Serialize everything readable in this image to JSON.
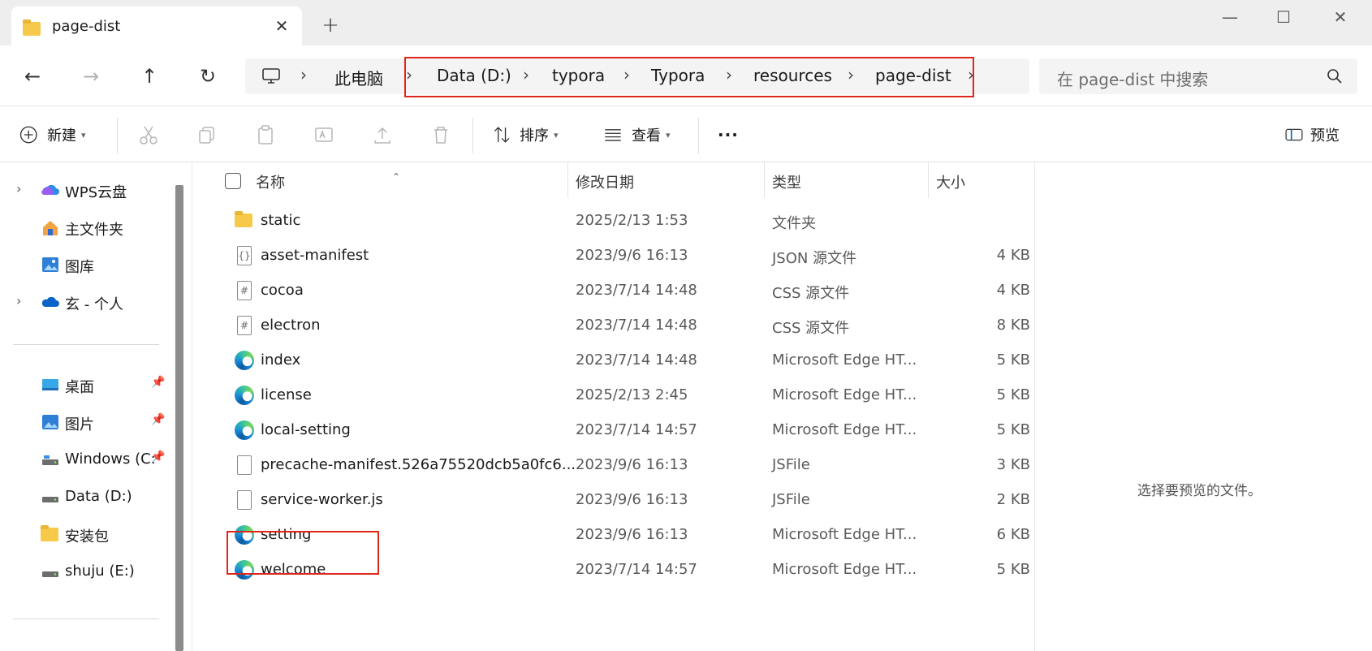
{
  "window": {
    "tab_title": "page-dist",
    "tab_close": "✕",
    "new_tab": "+",
    "minimize": "—",
    "maximize": "☐",
    "close": "✕"
  },
  "nav": {
    "back": "←",
    "forward": "→",
    "up": "↑",
    "refresh": "↻"
  },
  "breadcrumb": {
    "items": [
      "此电脑",
      "Data (D:)",
      "typora",
      "Typora",
      "resources",
      "page-dist"
    ],
    "separator": "›"
  },
  "search": {
    "placeholder": "在 page-dist 中搜索"
  },
  "toolbar": {
    "new_label": "新建",
    "sort_label": "排序",
    "view_label": "查看",
    "more_label": "···",
    "preview_label": "预览"
  },
  "sidebar": {
    "items": [
      {
        "label": "WPS云盘",
        "icon": "cloud-icon"
      },
      {
        "label": "主文件夹",
        "icon": "home-icon"
      },
      {
        "label": "图库",
        "icon": "gallery-icon"
      },
      {
        "label": "玄 - 个人",
        "icon": "onedrive-icon"
      },
      {
        "label": "桌面",
        "icon": "desktop-icon"
      },
      {
        "label": "图片",
        "icon": "pictures-icon"
      },
      {
        "label": "Windows (C:",
        "icon": "drive-icon"
      },
      {
        "label": "Data (D:)",
        "icon": "drive-icon"
      },
      {
        "label": "安装包",
        "icon": "folder-icon"
      },
      {
        "label": "shuju (E:)",
        "icon": "drive-icon"
      }
    ]
  },
  "columns": {
    "name": "名称",
    "date": "修改日期",
    "type": "类型",
    "size": "大小"
  },
  "files": [
    {
      "name": "static",
      "date": "2025/2/13 1:53",
      "type": "文件夹",
      "size": "",
      "icon": "folder-icon"
    },
    {
      "name": "asset-manifest",
      "date": "2023/9/6 16:13",
      "type": "JSON 源文件",
      "size": "4 KB",
      "icon": "json-file-icon"
    },
    {
      "name": "cocoa",
      "date": "2023/7/14 14:48",
      "type": "CSS 源文件",
      "size": "4 KB",
      "icon": "css-file-icon"
    },
    {
      "name": "electron",
      "date": "2023/7/14 14:48",
      "type": "CSS 源文件",
      "size": "8 KB",
      "icon": "css-file-icon"
    },
    {
      "name": "index",
      "date": "2023/7/14 14:48",
      "type": "Microsoft Edge HT...",
      "size": "5 KB",
      "icon": "edge-icon"
    },
    {
      "name": "license",
      "date": "2025/2/13 2:45",
      "type": "Microsoft Edge HT...",
      "size": "5 KB",
      "icon": "edge-icon"
    },
    {
      "name": "local-setting",
      "date": "2023/7/14 14:57",
      "type": "Microsoft Edge HT...",
      "size": "5 KB",
      "icon": "edge-icon"
    },
    {
      "name": "precache-manifest.526a75520dcb5a0fc6...",
      "date": "2023/9/6 16:13",
      "type": "JSFile",
      "size": "3 KB",
      "icon": "file-icon"
    },
    {
      "name": "service-worker.js",
      "date": "2023/9/6 16:13",
      "type": "JSFile",
      "size": "2 KB",
      "icon": "file-icon"
    },
    {
      "name": "setting",
      "date": "2023/9/6 16:13",
      "type": "Microsoft Edge HT...",
      "size": "6 KB",
      "icon": "edge-icon"
    },
    {
      "name": "welcome",
      "date": "2023/7/14 14:57",
      "type": "Microsoft Edge HT...",
      "size": "5 KB",
      "icon": "edge-icon"
    }
  ],
  "preview": {
    "message": "选择要预览的文件。"
  },
  "colors": {
    "highlight_box": "#e0251b",
    "folder": "#f7c94b",
    "accent": "#0067c0"
  }
}
